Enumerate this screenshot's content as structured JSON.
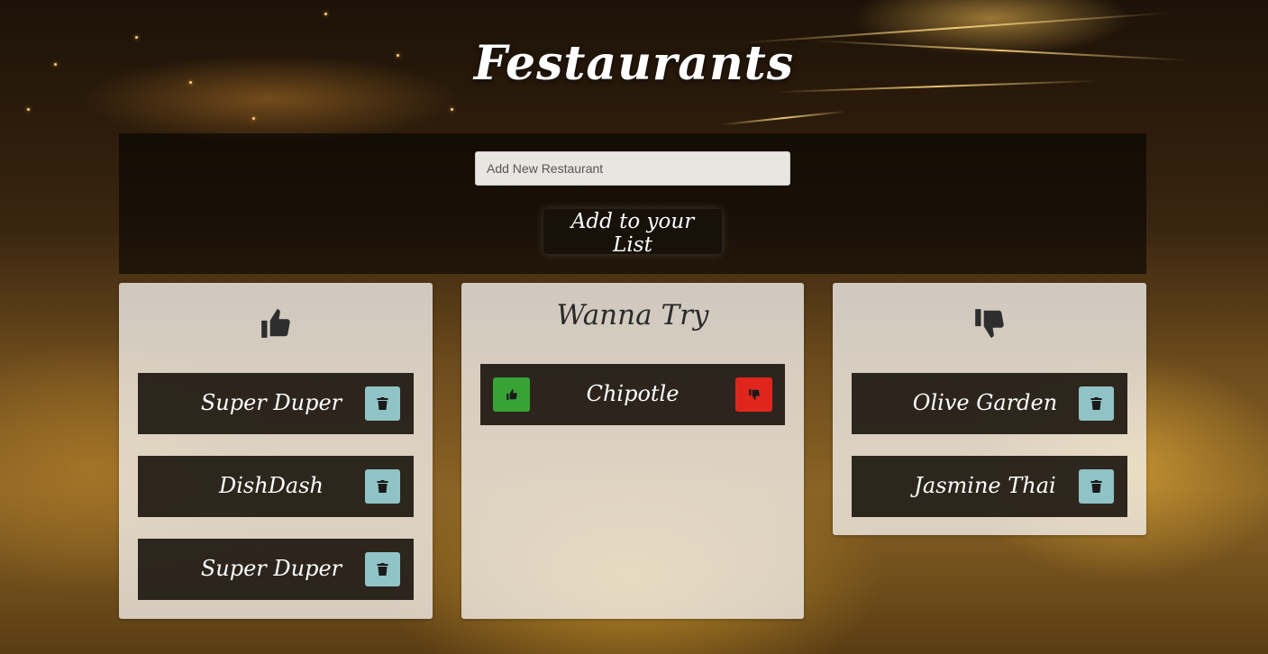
{
  "app": {
    "title": "Festaurants"
  },
  "form": {
    "input_placeholder": "Add New Restaurant",
    "input_value": "",
    "add_button_label": "Add to your List"
  },
  "columns": {
    "liked": {
      "icon": "thumbs-up-icon",
      "items": [
        {
          "name": "Super Duper"
        },
        {
          "name": "DishDash"
        },
        {
          "name": "Super Duper"
        }
      ]
    },
    "wanna_try": {
      "heading": "Wanna Try",
      "items": [
        {
          "name": "Chipotle"
        }
      ]
    },
    "disliked": {
      "icon": "thumbs-down-icon",
      "items": [
        {
          "name": "Olive Garden"
        },
        {
          "name": "Jasmine Thai"
        }
      ]
    }
  },
  "icons": {
    "delete": "trash-icon",
    "like": "thumbs-up-icon",
    "dislike": "thumbs-down-icon"
  },
  "colors": {
    "trash_button": "#8fc3c6",
    "like_button": "#37a335",
    "dislike_button": "#e0261c",
    "card_background": "#140e06"
  }
}
